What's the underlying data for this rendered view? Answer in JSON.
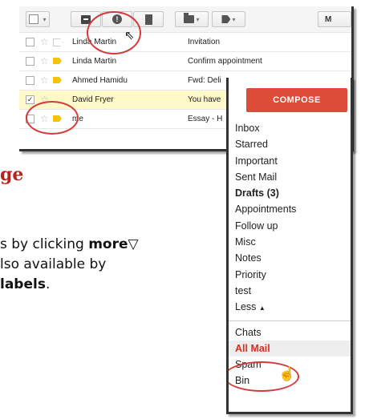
{
  "toolbar": {
    "icons": [
      "select-all-checkbox",
      "archive-icon",
      "report-spam-icon",
      "delete-icon",
      "move-to-icon",
      "labels-icon",
      "more-icon"
    ],
    "more_label": "M"
  },
  "emails": [
    {
      "sender": "Linda Martin",
      "subject": "Invitation",
      "important": false,
      "selected": false
    },
    {
      "sender": "Linda Martin",
      "subject": "Confirm appointment",
      "important": true,
      "selected": false
    },
    {
      "sender": "Ahmed Hamidu",
      "subject": "Fwd: Deli",
      "important": true,
      "selected": false
    },
    {
      "sender": "David Fryer",
      "subject": "You have",
      "important": false,
      "selected": true
    },
    {
      "sender": "me",
      "subject": "Essay - H",
      "important": true,
      "selected": false
    }
  ],
  "tutorial": {
    "heading": "ge",
    "line1_pre": "s by clicking ",
    "line1_bold": "more",
    "line1_symbol": "▽",
    "line2": "lso available by",
    "line3_bold": "labels",
    "line3_post": "."
  },
  "sidebar": {
    "compose_label": "COMPOSE",
    "items": [
      "Inbox",
      "Starred",
      "Important",
      "Sent Mail",
      "Drafts (3)",
      "Appointments",
      "Follow up",
      "Misc",
      "Notes",
      "Priority",
      "test"
    ],
    "less_label": "Less",
    "items2": [
      "Chats",
      "All Mail",
      "Spam",
      "Bin"
    ]
  },
  "colors": {
    "compose": "#dd4b39",
    "highlight_circle": "#d43a3a",
    "important_marker": "#f4c20d",
    "selected_row": "#fef9c8",
    "heading": "#b3261e"
  }
}
